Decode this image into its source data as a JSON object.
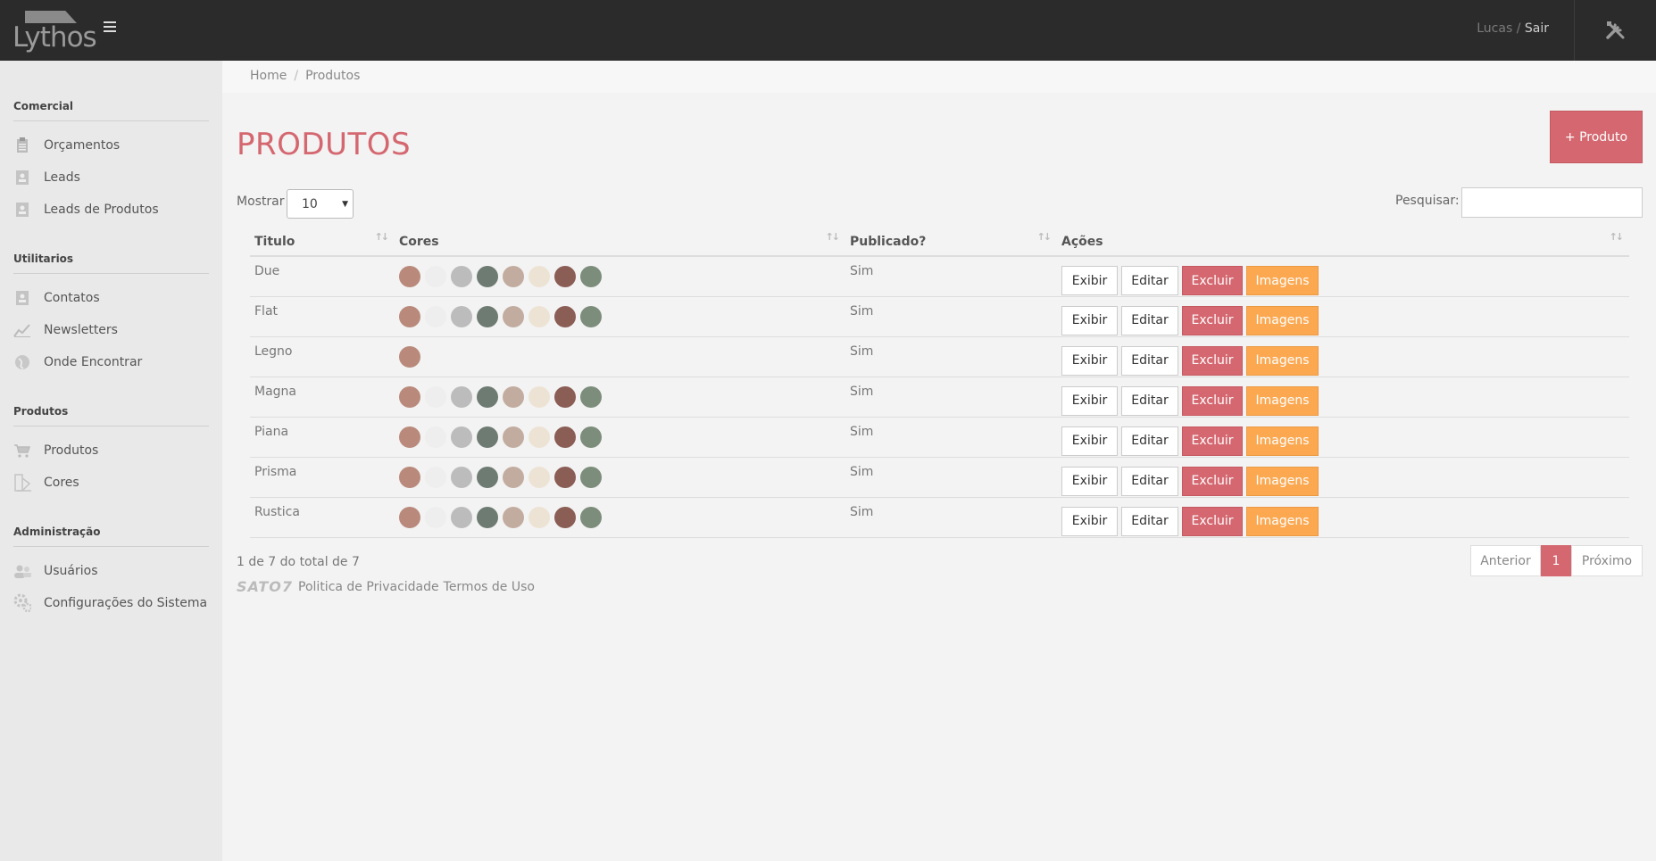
{
  "brand": {
    "logo_text": "Lythos"
  },
  "header": {
    "user_name": "Lucas",
    "separator": "/",
    "logout_label": "Sair"
  },
  "sidebar": {
    "sections": [
      {
        "title": "Comercial",
        "items": [
          {
            "label": "Orçamentos",
            "icon": "clipboard-icon"
          },
          {
            "label": "Leads",
            "icon": "contact-card-icon"
          },
          {
            "label": "Leads de Produtos",
            "icon": "contact-card-icon"
          }
        ]
      },
      {
        "title": "Utilitarios",
        "items": [
          {
            "label": "Contatos",
            "icon": "contact-card-icon"
          },
          {
            "label": "Newsletters",
            "icon": "chart-line-icon"
          },
          {
            "label": "Onde Encontrar",
            "icon": "globe-icon"
          }
        ]
      },
      {
        "title": "Produtos",
        "items": [
          {
            "label": "Produtos",
            "icon": "cart-icon"
          },
          {
            "label": "Cores",
            "icon": "palette-icon"
          }
        ]
      },
      {
        "title": "Administração",
        "items": [
          {
            "label": "Usuários",
            "icon": "users-icon"
          },
          {
            "label": "Configurações do Sistema",
            "icon": "gears-icon"
          }
        ]
      }
    ]
  },
  "breadcrumb": {
    "home": "Home",
    "current": "Produtos"
  },
  "page": {
    "title": "PRODUTOS",
    "add_button": "+ Produto"
  },
  "controls": {
    "show_label": "Mostrar",
    "show_value": "10",
    "search_label": "Pesquisar:",
    "search_value": ""
  },
  "table": {
    "headers": {
      "title": "Titulo",
      "colors": "Cores",
      "published": "Publicado?",
      "actions": "Ações"
    },
    "action_labels": {
      "view": "Exibir",
      "edit": "Editar",
      "delete": "Excluir",
      "images": "Imagens"
    },
    "palette": [
      "#b98a7b",
      "#eeeeee",
      "#bcbcbc",
      "#6e7b73",
      "#c2ac9f",
      "#ede3d5",
      "#8a5d55",
      "#7d8d7b"
    ],
    "rows": [
      {
        "title": "Due",
        "swatch_count": 8,
        "published": "Sim"
      },
      {
        "title": "Flat",
        "swatch_count": 8,
        "published": "Sim"
      },
      {
        "title": "Legno",
        "swatch_count": 1,
        "published": "Sim"
      },
      {
        "title": "Magna",
        "swatch_count": 8,
        "published": "Sim"
      },
      {
        "title": "Piana",
        "swatch_count": 8,
        "published": "Sim"
      },
      {
        "title": "Prisma",
        "swatch_count": 8,
        "published": "Sim"
      },
      {
        "title": "Rustica",
        "swatch_count": 8,
        "published": "Sim"
      }
    ]
  },
  "pagination": {
    "info": "1 de 7 do total de 7",
    "prev": "Anterior",
    "current": "1",
    "next": "Próximo"
  },
  "footer": {
    "brand": "SATO7",
    "privacy": "Politica de Privacidade",
    "terms": "Termos de Uso"
  },
  "colors": {
    "accent": "#d4676f",
    "warning": "#fba851",
    "topbar": "#2b2b2b"
  }
}
